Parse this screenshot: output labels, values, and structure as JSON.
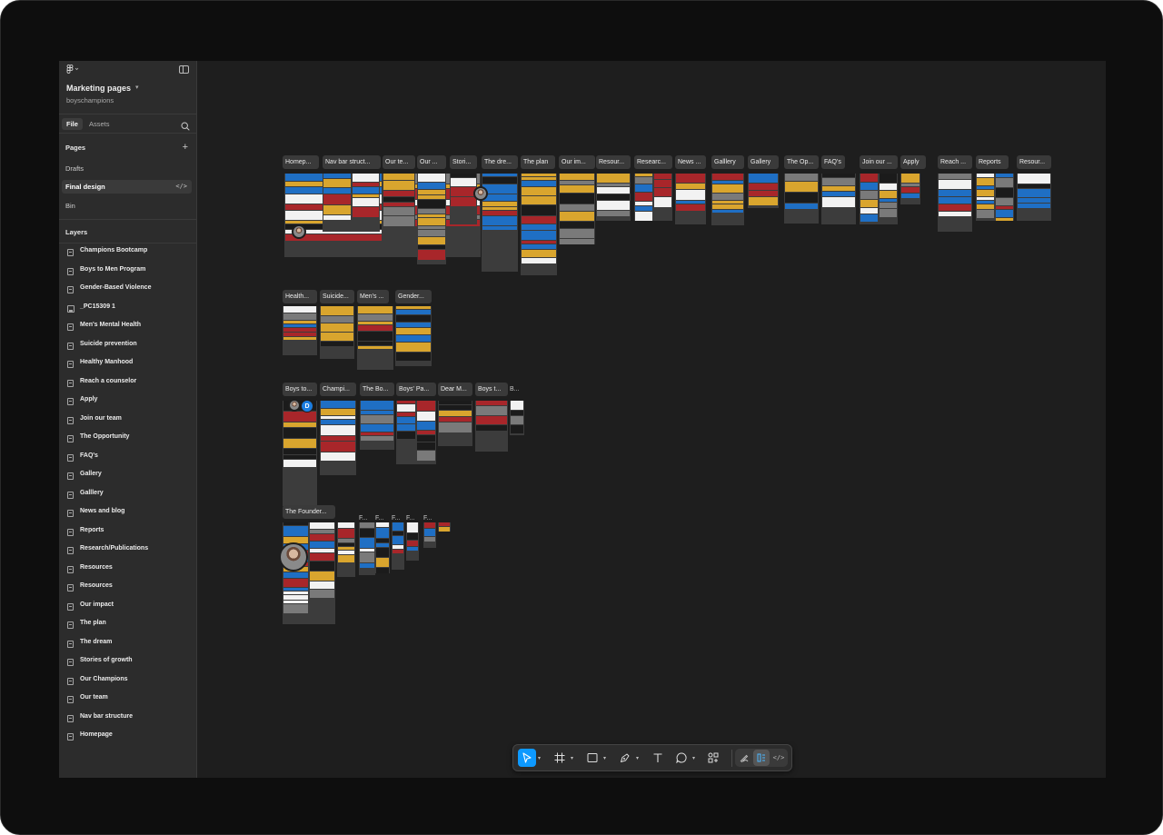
{
  "file": {
    "name": "Marketing pages",
    "team": "boyschampions"
  },
  "tabs": {
    "file": "File",
    "assets": "Assets"
  },
  "pages": {
    "title": "Pages",
    "items": [
      "Drafts",
      "Final design",
      "Bin"
    ],
    "selected": "Final design"
  },
  "layers": {
    "title": "Layers",
    "items": [
      "Champions Bootcamp",
      "Boys to Men Program",
      "Gender-Based Violence",
      "_PC15309 1",
      "Men's Mental Health",
      "Suicide prevention",
      "Healthy Manhood",
      "Reach a counselor",
      "Apply",
      "Join our team",
      "The Opportunity",
      "FAQ's",
      "Gallery",
      "Galllery",
      "News and blog",
      "Reports",
      "Research/Publications",
      "Resources",
      "Resources",
      "Our impact",
      "The plan",
      "The dream",
      "Stories of growth",
      "Our Champions",
      "Our team",
      "Nav bar structure",
      "Homepage"
    ]
  },
  "canvas": {
    "row1_labels": [
      "Homep...",
      "Nav bar struct...",
      "Our te...",
      "Our ...",
      "Stori...",
      "The dre...",
      "The plan",
      "Our im...",
      "Resour...",
      "Researc...",
      "News ...",
      "Galllery",
      "Gallery",
      "The Op...",
      "FAQ's",
      "Join our ...",
      "Apply",
      "Reach ...",
      "Reports",
      "Resour..."
    ],
    "row2_labels": [
      "Health...",
      "Suicide...",
      "Men's ...",
      "Gender..."
    ],
    "row3_labels": [
      "Boys to...",
      "Champi...",
      "The Bo...",
      "Boys' Pa...",
      "Dear M...",
      "Boys t...",
      "B..."
    ],
    "row4_labels": [
      "The Founder...",
      "F...",
      "F...",
      "F...",
      "F...",
      "F..."
    ],
    "collaborator_initial": "D"
  },
  "colors": {
    "accent": "#0d99ff",
    "brand_blue": "#1f6fc4",
    "brand_red": "#a8262a",
    "brand_gold": "#d9a52e"
  },
  "icons": {
    "toolbar": [
      "move-icon",
      "frame-icon",
      "rectangle-icon",
      "pen-icon",
      "text-icon",
      "comment-icon",
      "actions-icon"
    ],
    "modes": [
      "draw-mode-icon",
      "design-mode-icon",
      "dev-mode-icon"
    ]
  }
}
